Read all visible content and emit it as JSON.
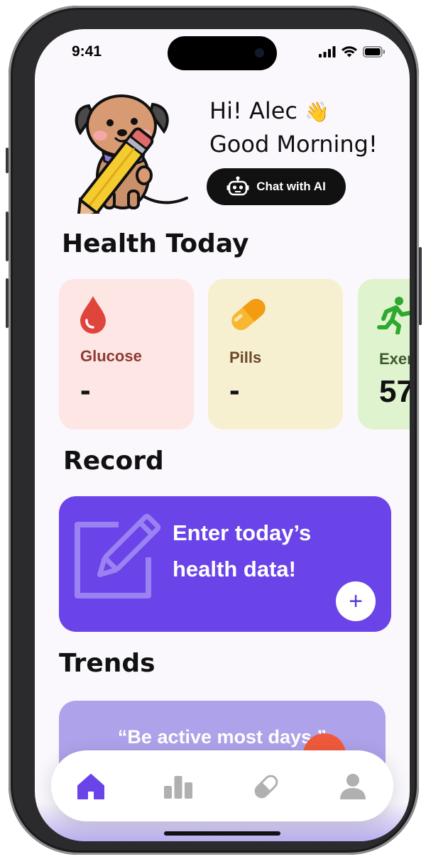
{
  "status_bar": {
    "time": "9:41"
  },
  "greeting": {
    "line1": "Hi! Alec",
    "wave_emoji": "👋",
    "line2": "Good Morning!"
  },
  "chat_button": {
    "label": "Chat with AI",
    "icon": "robot-icon"
  },
  "sections": {
    "health_today": "Health Today",
    "record": "Record",
    "trends": "Trends"
  },
  "health_cards": [
    {
      "label": "Glucose",
      "value": "-",
      "icon": "blood-drop-icon",
      "bg": "#fde6e4",
      "label_color": "#8e3a35"
    },
    {
      "label": "Pills",
      "value": "-",
      "icon": "pill-icon",
      "bg": "#f6f0d0",
      "label_color": "#6b4a2a"
    },
    {
      "label": "Exer",
      "value": "57",
      "icon": "running-person-icon",
      "bg": "#dff3cf",
      "label_color": "#3d5a2b"
    }
  ],
  "record_card": {
    "text": "Enter today’s health data!",
    "icon": "edit-note-icon",
    "action": "+"
  },
  "trends_card": {
    "quote": "“Be active most days.”"
  },
  "nav": [
    {
      "name": "home",
      "icon": "home-icon",
      "active": true
    },
    {
      "name": "stats",
      "icon": "bar-chart-icon",
      "active": false
    },
    {
      "name": "pills",
      "icon": "pill-icon",
      "active": false
    },
    {
      "name": "profile",
      "icon": "person-icon",
      "active": false
    }
  ],
  "colors": {
    "accent": "#6a44e8",
    "background": "#faf8fc"
  }
}
